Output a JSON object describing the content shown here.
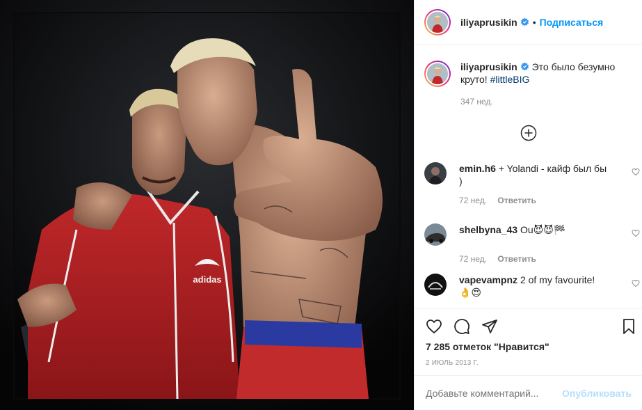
{
  "post": {
    "username": "iliyaprusikin",
    "follow_label": "Подписаться",
    "dot": "•",
    "caption_text": "Это было безумно круто!",
    "caption_hashtag": "#littleBIG",
    "caption_time": "347 нед.",
    "likes": "7 285 отметок \"Нравится\"",
    "date": "2 ИЮЛЬ 2013 Г.",
    "comment_placeholder": "Добавьте комментарий...",
    "publish_label": "Опубликовать",
    "photo_print": "adidas"
  },
  "comments": [
    {
      "user": "emin.h6",
      "text": "+ Yolandi - кайф был бы )",
      "time": "72 нед.",
      "reply": "Ответить"
    },
    {
      "user": "shelbyna_43",
      "text": "Ou😈😈🏁",
      "time": "72 нед.",
      "reply": "Ответить"
    },
    {
      "user": "vapevampnz",
      "text": "2 of my favourite! 👌😍",
      "time": "",
      "reply": ""
    }
  ],
  "colors": {
    "accent": "#0095f6",
    "text": "#262626",
    "muted": "#8e8e8e",
    "publish_disabled": "#b2dffc",
    "border": "#efefef"
  },
  "icons": [
    "verified-icon",
    "load-more-icon",
    "heart-icon",
    "comment-icon",
    "share-icon",
    "bookmark-icon"
  ]
}
